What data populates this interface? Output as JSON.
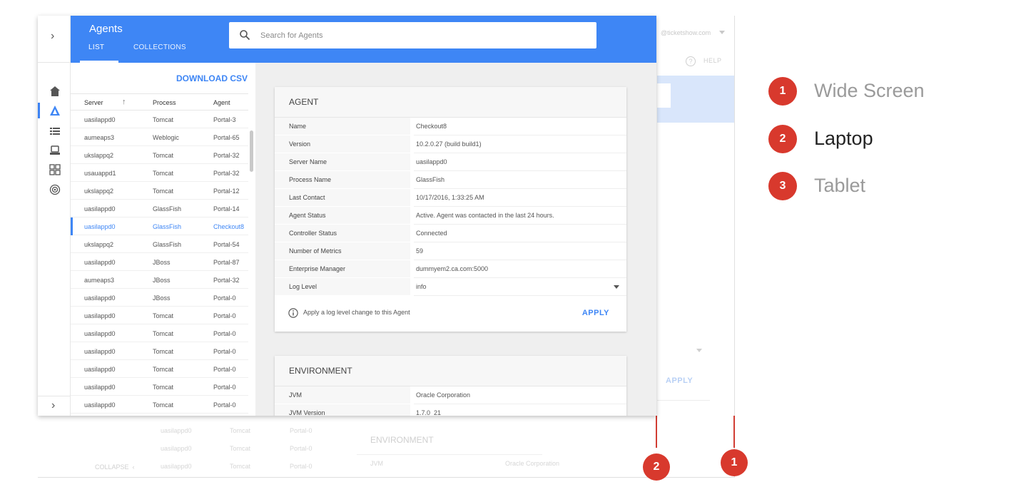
{
  "legend": [
    {
      "number": "1",
      "label": "Wide Screen",
      "color": "#9a9a9a"
    },
    {
      "number": "2",
      "label": "Laptop",
      "color": "#222222"
    },
    {
      "number": "3",
      "label": "Tablet",
      "color": "#9a9a9a"
    }
  ],
  "markers": {
    "laptop": "2",
    "wide": "1"
  },
  "accent_color": "#3e86f5",
  "marker_color": "#d8392d",
  "background": {
    "email": "@ticketshow.com",
    "help": "HELP",
    "apply": "APPLY",
    "rows": [
      {
        "server": "uasilappd0",
        "process": "Tomcat",
        "agent": "Portal-0"
      },
      {
        "server": "uasilappd0",
        "process": "Tomcat",
        "agent": "Portal-0"
      },
      {
        "server": "uasilappd0",
        "process": "Tomcat",
        "agent": "Portal-0"
      }
    ],
    "collapse": "COLLAPSE",
    "environment_title": "ENVIRONMENT",
    "env_row": {
      "key": "JVM",
      "value": "Oracle Corporation"
    }
  },
  "app": {
    "title": "Agents",
    "tabs": [
      {
        "label": "LIST",
        "active": true
      },
      {
        "label": "COLLECTIONS",
        "active": false
      }
    ],
    "search_placeholder": "Search for Agents",
    "rail_icons": [
      "home-icon",
      "agents-icon",
      "list-icon",
      "monitor-icon",
      "dashboard-icon",
      "signal-icon"
    ]
  },
  "list": {
    "download_csv": "DOWNLOAD CSV",
    "columns": {
      "server": "Server",
      "process": "Process",
      "agent": "Agent"
    },
    "rows": [
      {
        "server": "uasilappd0",
        "process": "Tomcat",
        "agent": "Portal-3"
      },
      {
        "server": "aumeaps3",
        "process": "Weblogic",
        "agent": "Portal-65"
      },
      {
        "server": "ukslappq2",
        "process": "Tomcat",
        "agent": "Portal-32"
      },
      {
        "server": "usauappd1",
        "process": "Tomcat",
        "agent": "Portal-32"
      },
      {
        "server": "ukslappq2",
        "process": "Tomcat",
        "agent": "Portal-12"
      },
      {
        "server": "uasilappd0",
        "process": "GlassFish",
        "agent": "Portal-14"
      },
      {
        "server": "uasilappd0",
        "process": "GlassFish",
        "agent": "Checkout8",
        "selected": true
      },
      {
        "server": "ukslappq2",
        "process": "GlassFish",
        "agent": "Portal-54"
      },
      {
        "server": "uasilappd0",
        "process": "JBoss",
        "agent": "Portal-87"
      },
      {
        "server": "aumeaps3",
        "process": "JBoss",
        "agent": "Portal-32"
      },
      {
        "server": "uasilappd0",
        "process": "JBoss",
        "agent": "Portal-0"
      },
      {
        "server": "uasilappd0",
        "process": "Tomcat",
        "agent": "Portal-0"
      },
      {
        "server": "uasilappd0",
        "process": "Tomcat",
        "agent": "Portal-0"
      },
      {
        "server": "uasilappd0",
        "process": "Tomcat",
        "agent": "Portal-0"
      },
      {
        "server": "uasilappd0",
        "process": "Tomcat",
        "agent": "Portal-0"
      },
      {
        "server": "uasilappd0",
        "process": "Tomcat",
        "agent": "Portal-0"
      },
      {
        "server": "uasilappd0",
        "process": "Tomcat",
        "agent": "Portal-0"
      }
    ]
  },
  "agent_card": {
    "title": "AGENT",
    "fields": [
      {
        "key": "Name",
        "value": "Checkout8"
      },
      {
        "key": "Version",
        "value": "10.2.0.27 (build build1)"
      },
      {
        "key": "Server Name",
        "value": "uasilappd0"
      },
      {
        "key": "Process Name",
        "value": "GlassFish"
      },
      {
        "key": "Last Contact",
        "value": "10/17/2016, 1:33:25 AM"
      },
      {
        "key": "Agent Status",
        "value": "Active. Agent was contacted in the last 24 hours."
      },
      {
        "key": "Controller Status",
        "value": "Connected"
      },
      {
        "key": "Number of Metrics",
        "value": "59"
      },
      {
        "key": "Enterprise Manager",
        "value": "dummyem2.ca.com:5000"
      },
      {
        "key": "Log Level",
        "value": "info",
        "dropdown": true
      }
    ],
    "info_text": "Apply a log level change to this Agent",
    "apply": "APPLY"
  },
  "environment_card": {
    "title": "ENVIRONMENT",
    "fields": [
      {
        "key": "JVM",
        "value": "Oracle Corporation"
      },
      {
        "key": "JVM Version",
        "value": "1.7.0_21"
      }
    ]
  }
}
